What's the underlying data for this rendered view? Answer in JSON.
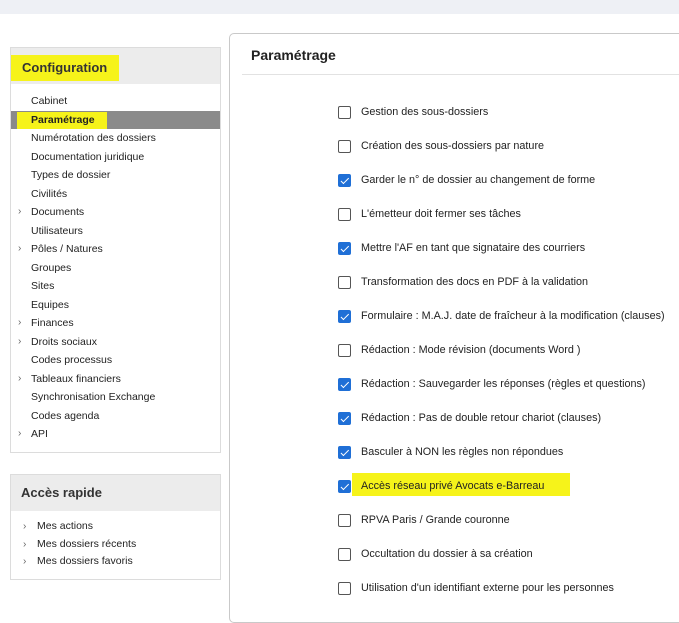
{
  "sidebar": {
    "config_title": "Configuration",
    "items": [
      {
        "label": "Cabinet",
        "chevron": false,
        "active": false
      },
      {
        "label": "Paramétrage",
        "chevron": false,
        "active": true
      },
      {
        "label": "Numérotation des dossiers",
        "chevron": false,
        "active": false
      },
      {
        "label": "Documentation juridique",
        "chevron": false,
        "active": false
      },
      {
        "label": "Types de dossier",
        "chevron": false,
        "active": false
      },
      {
        "label": "Civilités",
        "chevron": false,
        "active": false
      },
      {
        "label": "Documents",
        "chevron": true,
        "active": false
      },
      {
        "label": "Utilisateurs",
        "chevron": false,
        "active": false
      },
      {
        "label": "Pôles / Natures",
        "chevron": true,
        "active": false
      },
      {
        "label": "Groupes",
        "chevron": false,
        "active": false
      },
      {
        "label": "Sites",
        "chevron": false,
        "active": false
      },
      {
        "label": "Equipes",
        "chevron": false,
        "active": false
      },
      {
        "label": "Finances",
        "chevron": true,
        "active": false
      },
      {
        "label": "Droits sociaux",
        "chevron": true,
        "active": false
      },
      {
        "label": "Codes processus",
        "chevron": false,
        "active": false
      },
      {
        "label": "Tableaux financiers",
        "chevron": true,
        "active": false
      },
      {
        "label": "Synchronisation Exchange",
        "chevron": false,
        "active": false
      },
      {
        "label": "Codes agenda",
        "chevron": false,
        "active": false
      },
      {
        "label": "API",
        "chevron": true,
        "active": false
      }
    ],
    "chevron_glyph": "›"
  },
  "quick_access": {
    "title": "Accès rapide",
    "items": [
      {
        "label": "Mes actions"
      },
      {
        "label": "Mes dossiers récents"
      },
      {
        "label": "Mes dossiers favoris"
      }
    ]
  },
  "main": {
    "title": "Paramétrage",
    "options": [
      {
        "label": "Gestion des sous-dossiers",
        "checked": false
      },
      {
        "label": "Création des sous-dossiers par nature",
        "checked": false
      },
      {
        "label": "Garder le n° de dossier au changement de forme",
        "checked": true
      },
      {
        "label": "L'émetteur doit fermer ses tâches",
        "checked": false
      },
      {
        "label": "Mettre l'AF en tant que signataire des courriers",
        "checked": true
      },
      {
        "label": "Transformation des docs en PDF à la validation",
        "checked": false
      },
      {
        "label": "Formulaire : M.A.J. date de fraîcheur à la modification (clauses)",
        "checked": true
      },
      {
        "label": "Rédaction : Mode révision (documents Word )",
        "checked": false
      },
      {
        "label": "Rédaction : Sauvegarder les réponses (règles et questions)",
        "checked": true
      },
      {
        "label": "Rédaction : Pas de double retour chariot (clauses)",
        "checked": true
      },
      {
        "label": "Basculer à NON les règles non répondues",
        "checked": true
      },
      {
        "label": "Accès réseau privé Avocats e-Barreau",
        "checked": true,
        "highlighted": true
      },
      {
        "label": "RPVA Paris / Grande couronne",
        "checked": false
      },
      {
        "label": "Occultation du dossier à sa création",
        "checked": false
      },
      {
        "label": "Utilisation d'un identifiant externe pour les personnes",
        "checked": false
      }
    ]
  },
  "colors": {
    "highlight": "#f6f31a",
    "active_item_bg": "#8a8a8a",
    "checkbox_checked": "#1f6fd6"
  }
}
